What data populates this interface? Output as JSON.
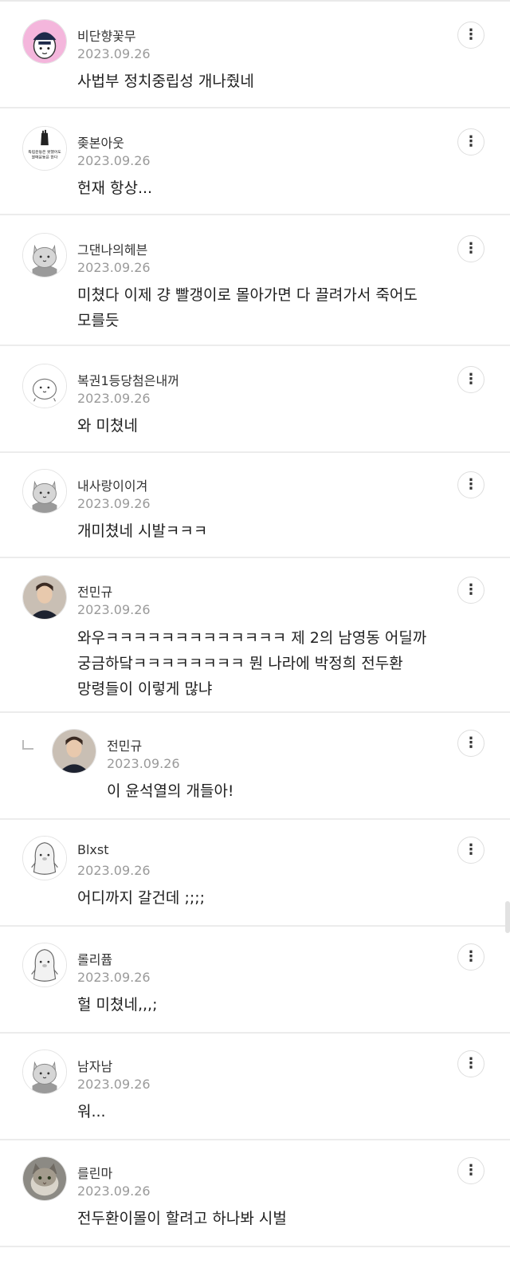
{
  "comments": [
    {
      "nickname": "비단향꽃무",
      "date": "2023.09.26",
      "text": "사법부 정치중립성 개나줬네",
      "avatar": "pink-character-avatar",
      "more_icon": "⋮"
    },
    {
      "nickname": "좆본아웃",
      "date": "2023.09.26",
      "text": "헌재 항상...",
      "avatar": "fist-slogan-avatar",
      "avatar_caption_1": "독립운동은 못했어도",
      "avatar_caption_2": "불매운동은 한다",
      "more_icon": "⋮"
    },
    {
      "nickname": "그댄나의헤븐",
      "date": "2023.09.26",
      "text_line_1": "미쳤다 이제 걍 빨갱이로 몰아가면 다 끌려가서 죽어도",
      "text_line_2": "모를듯",
      "avatar": "gray-cat-avatar",
      "more_icon": "⋮"
    },
    {
      "nickname": "복권1등당첨은내꺼",
      "date": "2023.09.26",
      "text": "와 미쳤네",
      "avatar": "white-blob-avatar",
      "more_icon": "⋮"
    },
    {
      "nickname": "내사랑이이겨",
      "date": "2023.09.26",
      "text": "개미쳤네 시발ㅋㅋㅋ",
      "avatar": "gray-cat-avatar",
      "more_icon": "⋮"
    },
    {
      "nickname": "전민규",
      "date": "2023.09.26",
      "text_line_1": "와우ㅋㅋㅋㅋㅋㅋㅋㅋㅋㅋㅋㅋㅋ 제 2의 남영동 어딜까",
      "text_line_2": "궁금하닼ㅋㅋㅋㅋㅋㅋㅋㅋ 뭔 나라에 박정희 전두환",
      "text_line_3": "망령들이 이렇게 많냐",
      "avatar": "person-photo-avatar",
      "more_icon": "⋮"
    },
    {
      "nickname": "전민규",
      "date": "2023.09.26",
      "text": "이 윤석열의 개들아!",
      "avatar": "person-photo-avatar",
      "is_reply": true,
      "reply_icon": "reply-arrow-icon",
      "more_icon": "⋮"
    },
    {
      "nickname": "Blxst",
      "date": "2023.09.26",
      "text": "어디까지 갈건데 ;;;;",
      "avatar": "penguin-avatar",
      "more_icon": "⋮"
    },
    {
      "nickname": "롤리퓹",
      "date": "2023.09.26",
      "text": "헐 미쳤네,,,;",
      "avatar": "penguin-avatar",
      "more_icon": "⋮"
    },
    {
      "nickname": "남자남",
      "date": "2023.09.26",
      "text": "워...",
      "avatar": "gray-cat-avatar",
      "more_icon": "⋮"
    },
    {
      "nickname": "를린마",
      "date": "2023.09.26",
      "text": "전두환이몰이 할려고 하나봐 시벌",
      "avatar": "cat-photo-avatar",
      "more_icon": "⋮"
    }
  ]
}
